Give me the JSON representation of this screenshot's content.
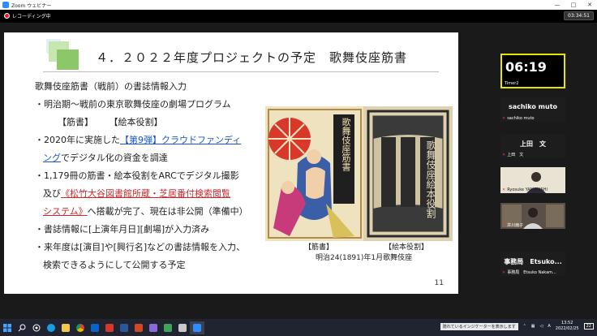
{
  "window": {
    "title": "Zoom ウェビナー",
    "controls": [
      "—",
      "□",
      "✕"
    ]
  },
  "topbar": {
    "recording_label": "レコーディング中",
    "elapsed": "03:34:51"
  },
  "slide": {
    "title": "４．２０２２年度プロジェクトの予定　歌舞伎座筋書",
    "body": {
      "line1": "歌舞伎座筋書（戦前）の書誌情報入力",
      "line2": "・明治期～戦前の東京歌舞伎座の劇場プログラム",
      "line3a": "【筋書】",
      "line3b": "【絵本役割】",
      "line4_pre": "・2020年に実施した",
      "line4_link": "【第9弾】クラウドファンディ",
      "line5_link": "ング",
      "line5_post": "でデジタル化の資金を調達",
      "line6": "・1,179冊の筋書・絵本役割をARCでデジタル撮影",
      "line7_pre": "及び",
      "line7_link": "《松竹大谷図書館所蔵・芝居番付検索閲覧",
      "line8_link": "システム》",
      "line8_post": "へ搭載が完了、現在は非公開（準備中）",
      "line9": "・書誌情報に[上演年月日][劇場]が入力済み",
      "line10": "・来年度は[演目]や[興行名]などの書誌情報を入力、",
      "line11": "検索できるようにして公開する予定"
    },
    "caption_left": "【筋書】",
    "caption_right": "【絵本役割】",
    "caption_date": "明治24(1891)年1月歌舞伎座",
    "page_number": "11",
    "image_left_text": "歌舞伎座筋書",
    "image_right_text": "歌舞伎座絵本役割"
  },
  "participants": {
    "timer": {
      "value": "06:19",
      "label": "Timer2"
    },
    "tiles": [
      {
        "name": "sachiko muto",
        "small": "sachiko muto",
        "type": "name"
      },
      {
        "name": "上田　文",
        "small": "上田　文",
        "type": "name"
      },
      {
        "name": "",
        "small": "Ryosuke YAMANISHI",
        "type": "video"
      },
      {
        "name": "",
        "small": "井川雨子",
        "type": "video"
      },
      {
        "name": "事務局　Etsuko...",
        "small": "事務局　Etsuko Nakam...",
        "type": "name"
      }
    ]
  },
  "taskbar": {
    "time": "13:52",
    "date": "2022/02/25",
    "tray_notice": "隠れているインジケーターを表示します",
    "notifications": "22",
    "apps": [
      "start-icon",
      "search-icon",
      "task-view-icon",
      "edge-icon",
      "explorer-icon",
      "chrome-icon",
      "outlook-icon",
      "acrobat-icon",
      "word-icon",
      "powerpoint-icon",
      "app-icon",
      "app-icon",
      "app-icon",
      "zoom-icon"
    ]
  },
  "colors": {
    "link_blue": "#1a55c8",
    "link_red": "#c82a2a",
    "timer_border": "#e5e500",
    "zoom_blue": "#2d8cff"
  }
}
